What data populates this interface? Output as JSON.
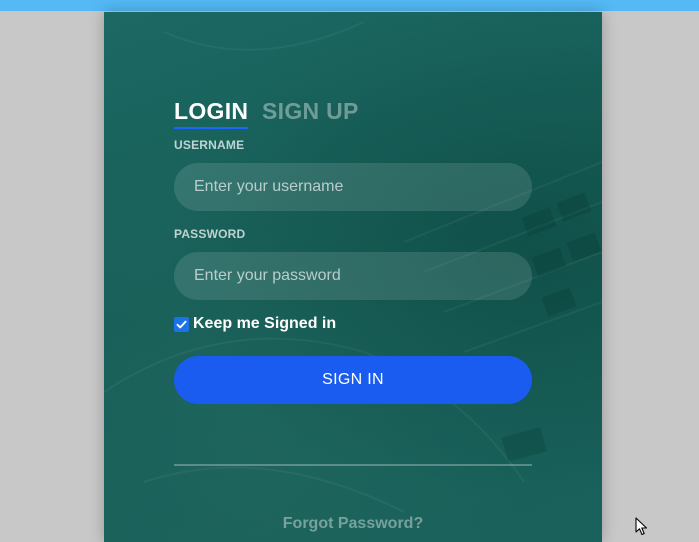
{
  "tabs": {
    "login": "LOGIN",
    "signup": "SIGN UP"
  },
  "username": {
    "label": "USERNAME",
    "placeholder": "Enter your username",
    "value": ""
  },
  "password": {
    "label": "PASSWORD",
    "placeholder": "Enter your password",
    "value": ""
  },
  "remember": {
    "label": "Keep me Signed in",
    "checked": true
  },
  "signin_label": "SIGN IN",
  "forgot_label": "Forgot Password?",
  "colors": {
    "top_bar": "#54b9f5",
    "card": "#1c6862",
    "accent": "#1a5cf0"
  },
  "icons": {
    "checkbox": "check-icon",
    "cursor": "mouse-pointer-icon"
  }
}
